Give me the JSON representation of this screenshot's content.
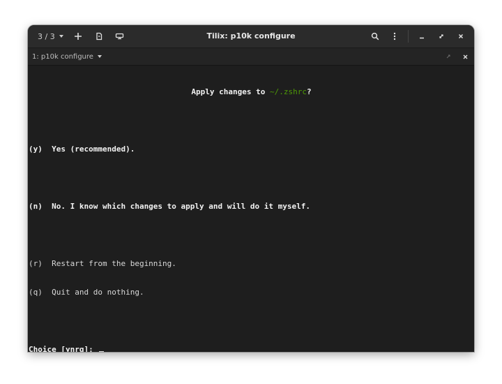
{
  "window": {
    "title": "Tilix: p10k configure"
  },
  "titlebar": {
    "session_indicator": "3 / 3",
    "icons": [
      "add-terminal-icon",
      "new-session-icon",
      "sync-input-icon"
    ],
    "right_icons": [
      "search-icon",
      "menu-icon",
      "minimize-icon",
      "maximize-icon",
      "close-icon"
    ]
  },
  "tab": {
    "label": "1: p10k configure"
  },
  "terminal": {
    "prompt_prefix": "Apply changes to ",
    "prompt_path": "~/.zshrc",
    "prompt_suffix": "?",
    "option_y": "(y)  Yes (recommended).",
    "option_n": "(n)  No. I know which changes to apply and will do it myself.",
    "option_r": "(r)  Restart from the beginning.",
    "option_q": "(q)  Quit and do nothing.",
    "choice_prompt": "Choice [ynrq]: ",
    "path_color": "#4e9a06"
  }
}
